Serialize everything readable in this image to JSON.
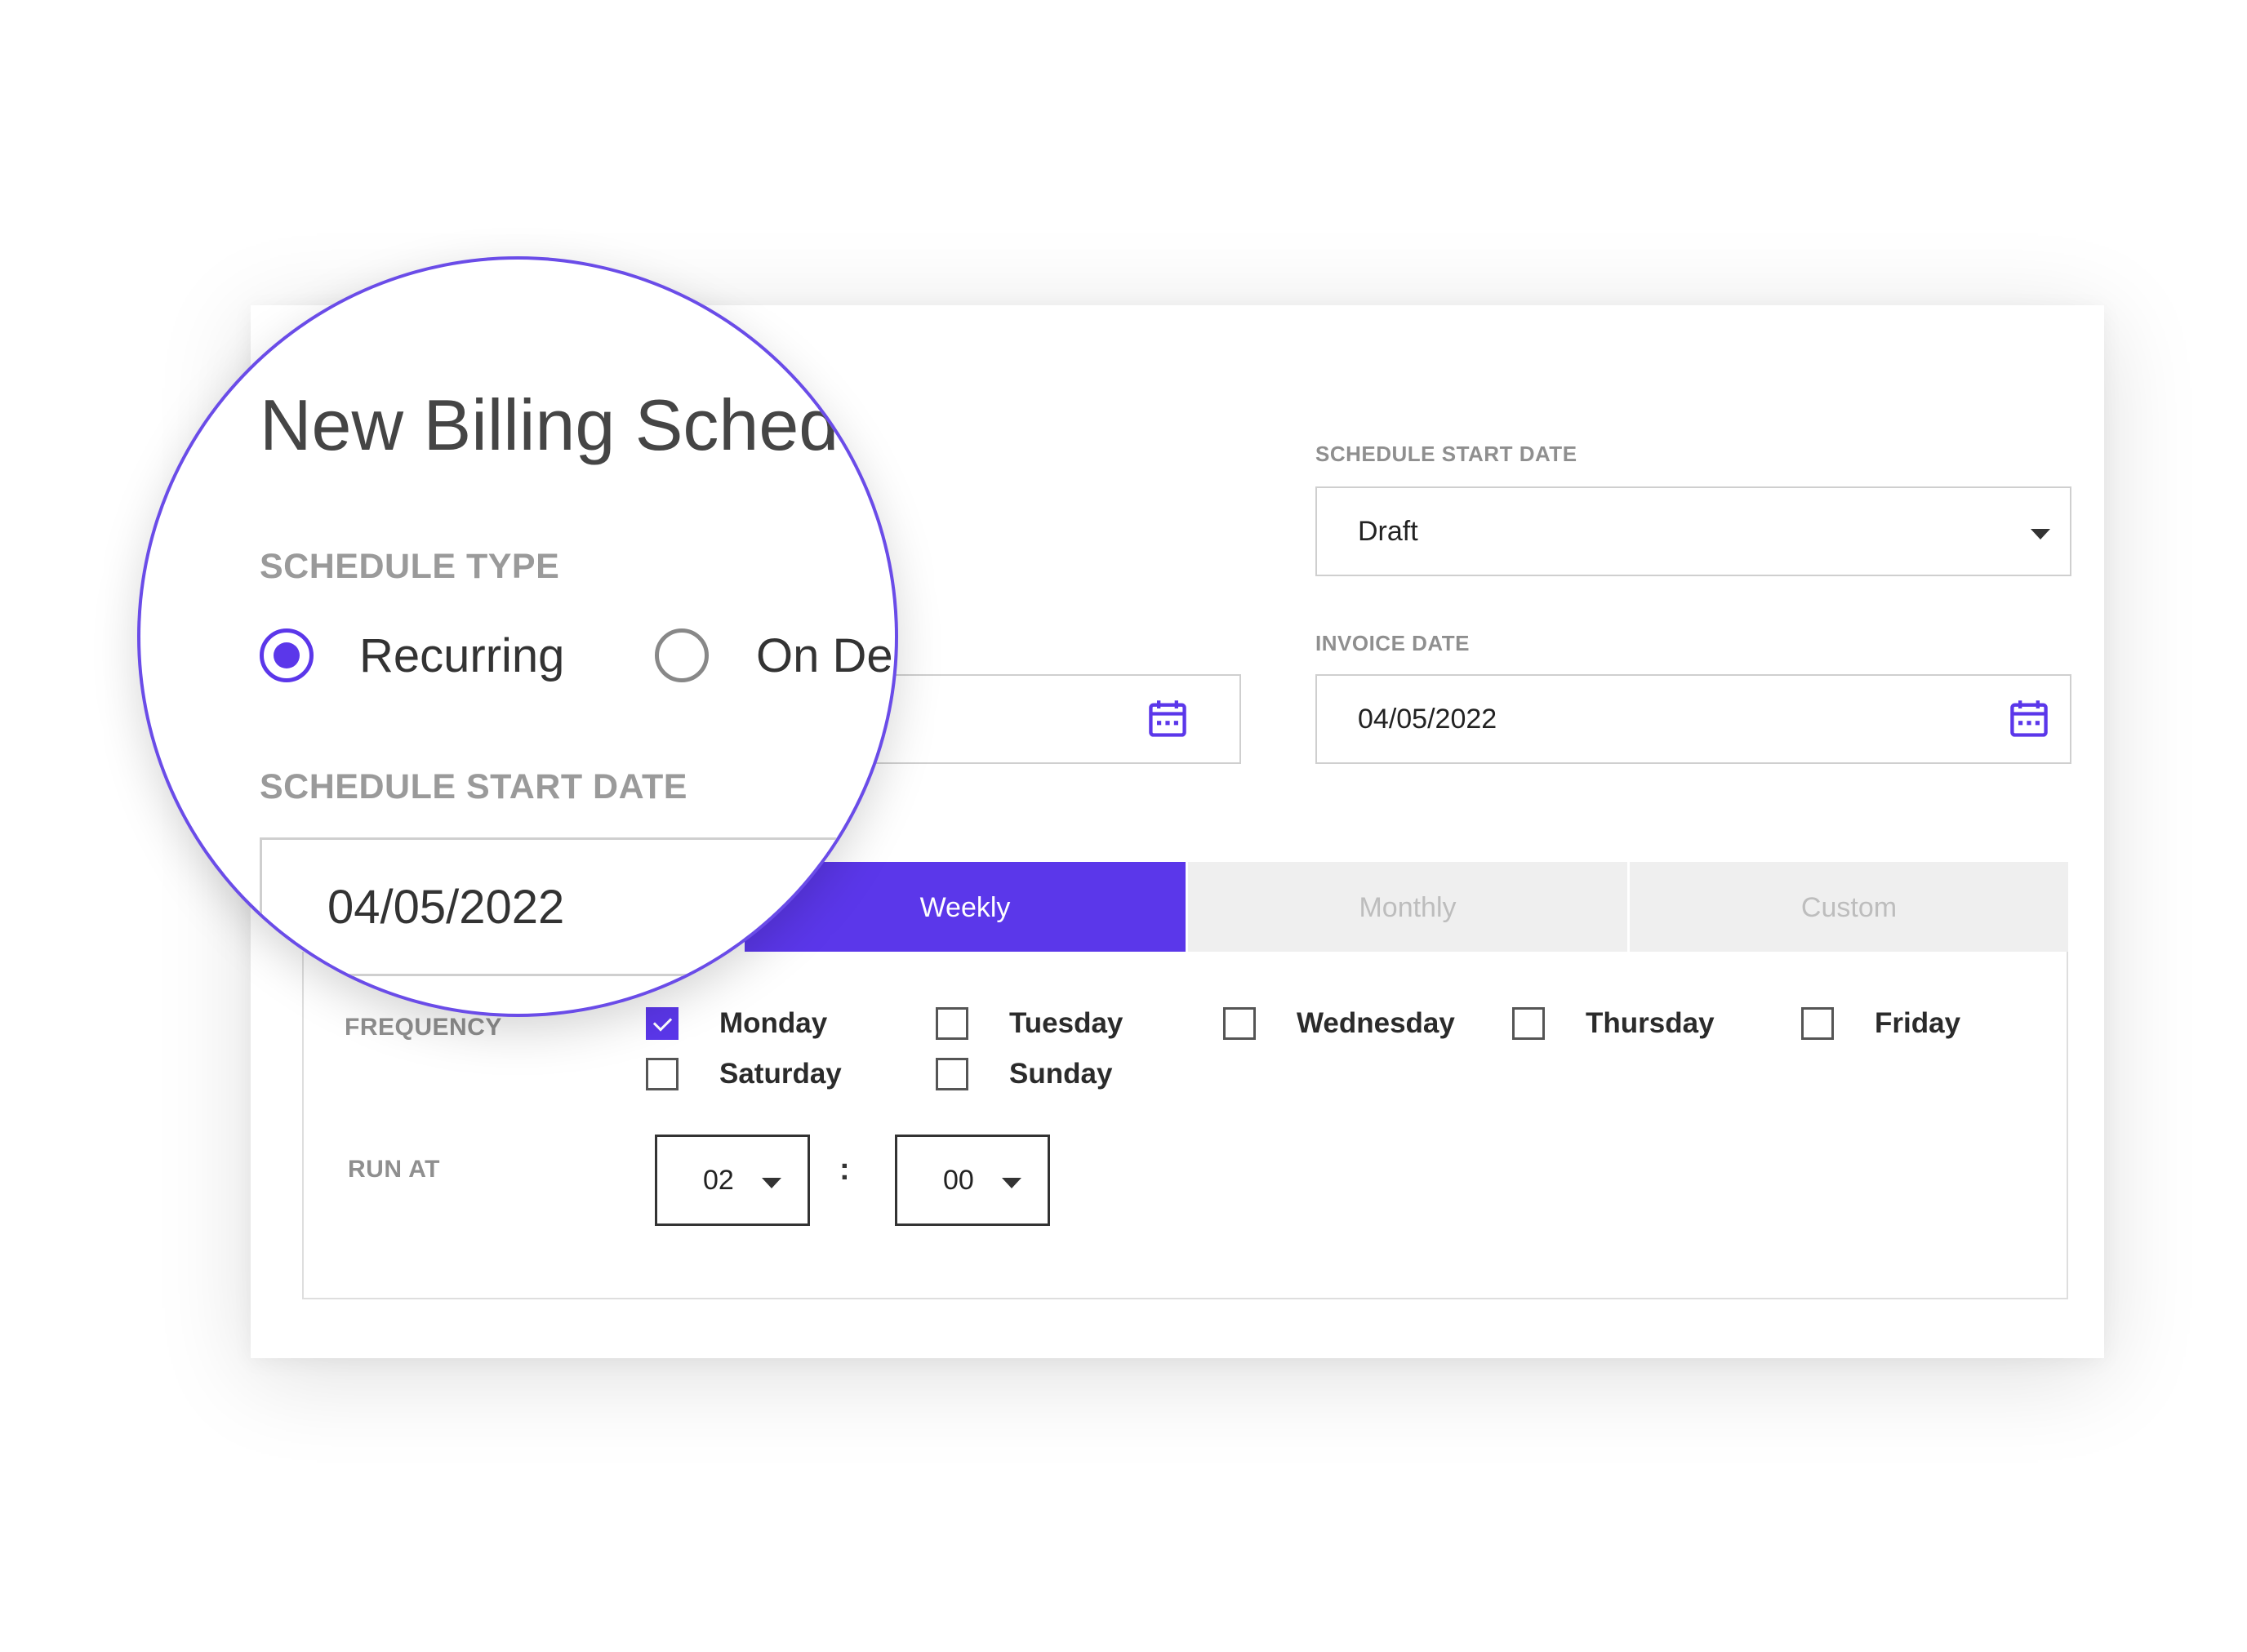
{
  "title": "New Billing Sched",
  "schedule_type": {
    "label": "SCHEDULE TYPE",
    "options": [
      {
        "label": "Recurring",
        "selected": true
      },
      {
        "label": "On De",
        "selected": false
      }
    ]
  },
  "schedule_start_date_left": {
    "label": "SCHEDULE START DATE",
    "value": "04/05/2022"
  },
  "schedule_start_date_right": {
    "label": "SCHEDULE START DATE",
    "value": "Draft"
  },
  "invoice_date": {
    "label": "INVOICE DATE",
    "value": "04/05/2022"
  },
  "tabs": [
    {
      "label": "Weekly",
      "active": true
    },
    {
      "label": "Monthly",
      "active": false
    },
    {
      "label": "Custom",
      "active": false
    }
  ],
  "frequency": {
    "label": "FREQUENCY",
    "days": [
      {
        "label": "Monday",
        "checked": true
      },
      {
        "label": "Tuesday",
        "checked": false
      },
      {
        "label": "Wednesday",
        "checked": false
      },
      {
        "label": "Thursday",
        "checked": false
      },
      {
        "label": "Friday",
        "checked": false
      },
      {
        "label": "Saturday",
        "checked": false
      },
      {
        "label": "Sunday",
        "checked": false
      }
    ]
  },
  "run_at": {
    "label": "RUN AT",
    "hour": "02",
    "minute": "00",
    "separator": ":"
  },
  "icons": {
    "calendar": "calendar-icon",
    "dropdown": "chevron-down-icon"
  },
  "colors": {
    "accent": "#5b37ea",
    "muted_label": "#8f8f8f",
    "tab_inactive_bg": "#efefef"
  }
}
